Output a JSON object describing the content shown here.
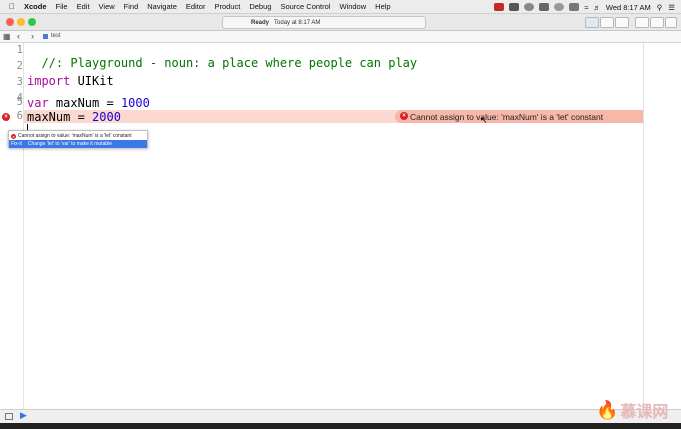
{
  "menubar": {
    "app": "Xcode",
    "items": [
      "File",
      "Edit",
      "View",
      "Find",
      "Navigate",
      "Editor",
      "Product",
      "Debug",
      "Source Control",
      "Window",
      "Help"
    ],
    "clock": "Wed 8:17 AM"
  },
  "toolbar": {
    "status": "Ready",
    "timestamp": "Today at 8:17 AM"
  },
  "jumpbar": {
    "file": "test"
  },
  "editor": {
    "lines": [
      {
        "num": "1",
        "text": "//: Playground - noun: a place where people can play"
      },
      {
        "num": "2",
        "text": ""
      },
      {
        "num": "3",
        "kw": "import",
        "rest": " UIKit"
      },
      {
        "num": "4",
        "text": ""
      },
      {
        "num": "5",
        "kw": "var",
        "mid": " maxNum = ",
        "val": "1000"
      },
      {
        "num": "6",
        "mid": "maxNum = ",
        "val": "2000"
      }
    ],
    "error_message": "Cannot assign to value: 'maxNum' is a 'let' constant"
  },
  "fixit": {
    "message": "Cannot assign to value: 'maxNum' is a 'let' constant",
    "label": "Fix-it",
    "suggestion": "Change 'let' to 'var' to make it mutable"
  },
  "watermark": "慕课网",
  "colors": {
    "error": "#d9222a",
    "error_band": "#fbd9d0",
    "keyword": "#aa0d91",
    "number": "#1c00cf",
    "comment": "#007400",
    "selection": "#3b78e7"
  }
}
